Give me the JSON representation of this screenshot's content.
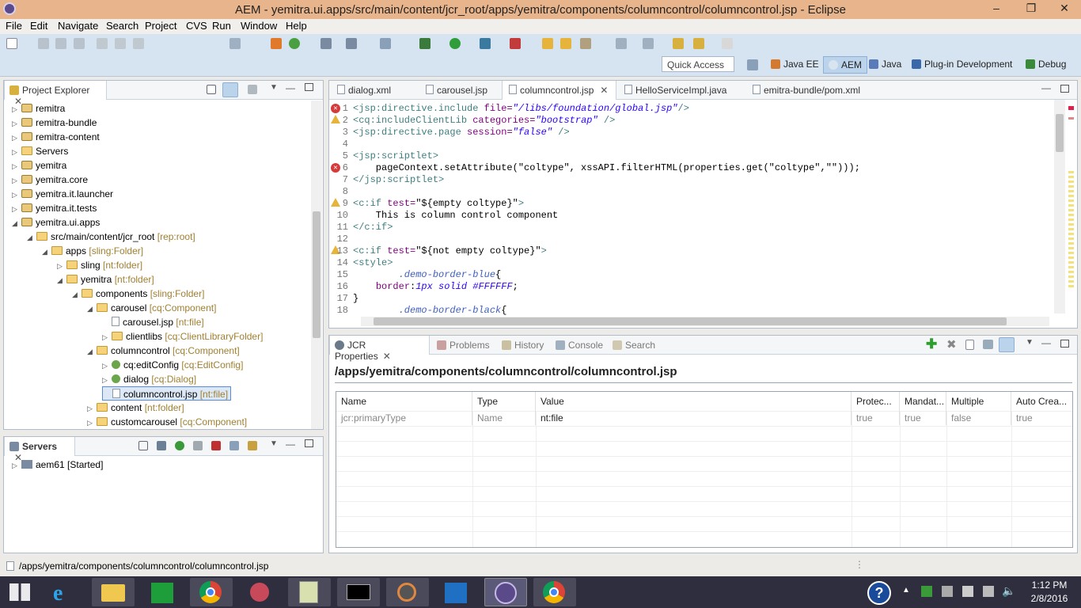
{
  "window": {
    "title": "AEM - yemitra.ui.apps/src/main/content/jcr_root/apps/yemitra/components/columncontrol/columncontrol.jsp - Eclipse"
  },
  "menu": [
    "File",
    "Edit",
    "Navigate",
    "Search",
    "Project",
    "CVS",
    "Run",
    "Window",
    "Help"
  ],
  "quick_access": "Quick Access",
  "perspectives": [
    "Java EE",
    "AEM",
    "Java",
    "Plug-in Development",
    "Debug"
  ],
  "project_explorer": {
    "title": "Project Explorer",
    "rows": [
      {
        "label": "remitra",
        "decor": ""
      },
      {
        "label": "remitra-bundle",
        "decor": ""
      },
      {
        "label": "remitra-content",
        "decor": ""
      },
      {
        "label": "Servers",
        "decor": ""
      },
      {
        "label": "yemitra",
        "decor": ""
      },
      {
        "label": "yemitra.core",
        "decor": ""
      },
      {
        "label": "yemitra.it.launcher",
        "decor": ""
      },
      {
        "label": "yemitra.it.tests",
        "decor": ""
      },
      {
        "label": "yemitra.ui.apps",
        "decor": ""
      },
      {
        "label": "src/main/content/jcr_root",
        "decor": "[rep:root]"
      },
      {
        "label": "apps",
        "decor": "[sling:Folder]"
      },
      {
        "label": "sling",
        "decor": "[nt:folder]"
      },
      {
        "label": "yemitra",
        "decor": "[nt:folder]"
      },
      {
        "label": "components",
        "decor": "[sling:Folder]"
      },
      {
        "label": "carousel",
        "decor": "[cq:Component]"
      },
      {
        "label": "carousel.jsp",
        "decor": "[nt:file]"
      },
      {
        "label": "clientlibs",
        "decor": "[cq:ClientLibraryFolder]"
      },
      {
        "label": "columncontrol",
        "decor": "[cq:Component]"
      },
      {
        "label": "cq:editConfig",
        "decor": "[cq:EditConfig]"
      },
      {
        "label": "dialog",
        "decor": "[cq:Dialog]"
      },
      {
        "label": "columncontrol.jsp",
        "decor": "[nt:file]"
      },
      {
        "label": "content",
        "decor": "[nt:folder]"
      },
      {
        "label": "customcarousel",
        "decor": "[cq:Component]"
      }
    ]
  },
  "servers": {
    "title": "Servers",
    "items": [
      {
        "name": "aem61",
        "state": "[Started]"
      }
    ]
  },
  "editor": {
    "tabs": [
      "dialog.xml",
      "carousel.jsp",
      "columncontrol.jsp",
      "HelloServiceImpl.java",
      "emitra-bundle/pom.xml"
    ],
    "lines": [
      {
        "n": "1"
      },
      {
        "n": "2"
      },
      {
        "n": "3"
      },
      {
        "n": "4"
      },
      {
        "n": "5"
      },
      {
        "n": "6"
      },
      {
        "n": "7"
      },
      {
        "n": "8"
      },
      {
        "n": "9"
      },
      {
        "n": "10"
      },
      {
        "n": "11"
      },
      {
        "n": "12"
      },
      {
        "n": "13"
      },
      {
        "n": "14"
      },
      {
        "n": "15"
      },
      {
        "n": "16"
      },
      {
        "n": "17"
      },
      {
        "n": "18"
      }
    ]
  },
  "bottom": {
    "tabs": [
      "JCR Properties",
      "Problems",
      "History",
      "Console",
      "Search"
    ],
    "path": "/apps/yemitra/components/columncontrol/columncontrol.jsp",
    "columns": [
      "Name",
      "Type",
      "Value",
      "Protec...",
      "Mandat...",
      "Multiple",
      "Auto Crea..."
    ],
    "row": [
      "jcr:primaryType",
      "Name",
      "nt:file",
      "true",
      "true",
      "false",
      "true"
    ]
  },
  "status": "/apps/yemitra/components/columncontrol/columncontrol.jsp",
  "clock": {
    "time": "1:12 PM",
    "date": "2/8/2016"
  }
}
